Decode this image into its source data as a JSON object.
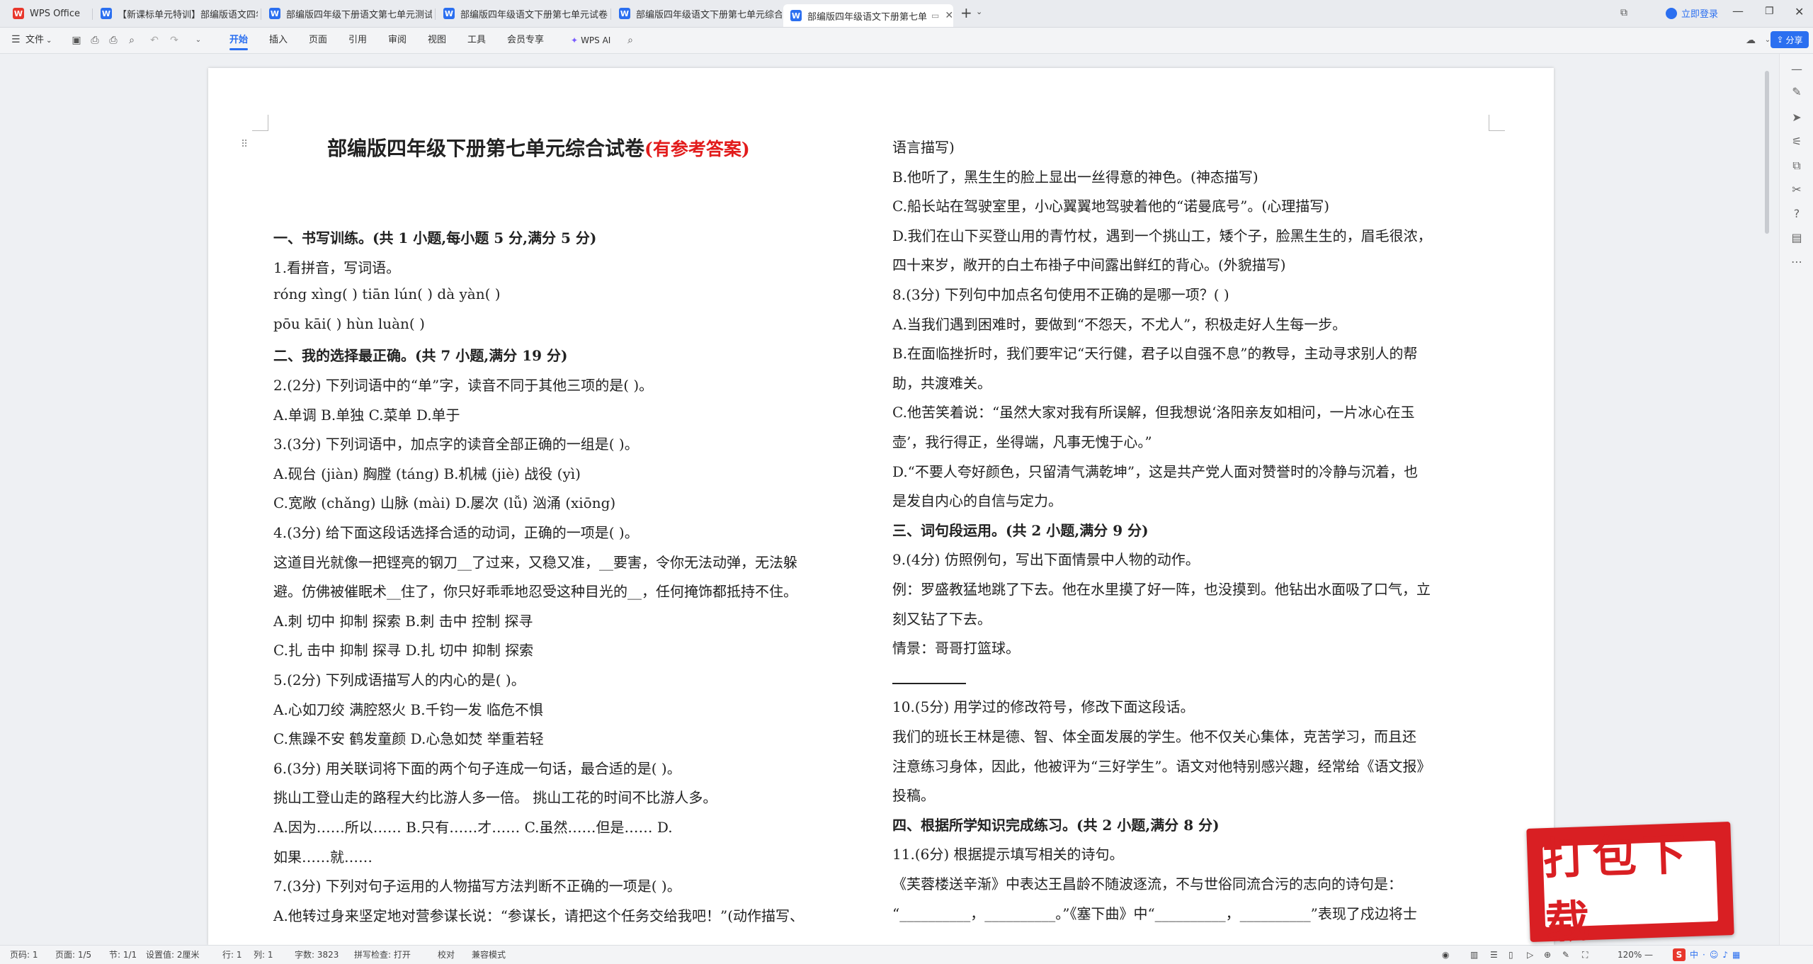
{
  "tabs": [
    {
      "label": "WPS Office",
      "type": "wps"
    },
    {
      "label": "【新课标单元特训】部编版语文四年",
      "type": "doc"
    },
    {
      "label": "部编版四年级下册语文第七单元测试",
      "type": "doc"
    },
    {
      "label": "部编版四年级语文下册第七单元试卷",
      "type": "doc"
    },
    {
      "label": "部编版四年级语文下册第七单元综合",
      "type": "doc"
    },
    {
      "label": "部编版四年级语文下册第七单",
      "type": "doc"
    }
  ],
  "titlebar": {
    "login": "立即登录",
    "new_tab": "+"
  },
  "menubar": {
    "file": "文件",
    "items": [
      "开始",
      "插入",
      "页面",
      "引用",
      "审阅",
      "视图",
      "工具",
      "会员专享"
    ],
    "ai": "WPS AI",
    "share": "分享"
  },
  "doc": {
    "title": "部编版四年级下册第七单元综合试卷",
    "title_red": "(有参考答案)",
    "left": [
      {
        "t": "一、书写训练。(共 1 小题,每小题 5 分,满分 5 分)",
        "bold": true
      },
      {
        "t": "1.看拼音，写词语。"
      },
      {
        "t": "róng xìng( )  tiān lún( ) dà yàn( )"
      },
      {
        "t": " pōu kāi( )  hùn luàn( )"
      },
      {
        "t": "二、我的选择最正确。(共 7 小题,满分 19 分)",
        "bold": true
      },
      {
        "t": "2.(2分) 下列词语中的“单”字，读音不同于其他三项的是(  )。"
      },
      {
        "t": "A.单调                B.单独                C.菜单                D.单于"
      },
      {
        "t": "3.(3分) 下列词语中，加点字的读音全部正确的一组是(  )。"
      },
      {
        "t": "A.砚台 (jiàn)        胸膛 (táng)   B.机械 (jiè)          战役 (yì)"
      },
      {
        "t": "C.宽敞 (chǎng)    山脉 (mài)         D.屡次 (lǚ)         汹涌 (xiōng)"
      },
      {
        "t": "4.(3分) 给下面这段话选择合适的动词，正确的一项是(  )。"
      },
      {
        "t": "  这道目光就像一把铿亮的钢刀__了过来，又稳又准，__要害，令你无法动弹，无法躲"
      },
      {
        "t": "避。仿佛被催眠术__住了，你只好乖乖地忍受这种目光的__，任何掩饰都抵持不住。"
      },
      {
        "t": "A.刺  切中  抑制  探索                   B.刺  击中  控制  探寻"
      },
      {
        "t": "C.扎  击中  抑制  探寻                   D.扎  切中  抑制  探索"
      },
      {
        "t": "5.(2分) 下列成语描写人的内心的是(  )。"
      },
      {
        "t": "A.心如刀绞  满腔怒火                     B.千钧一发  临危不惧"
      },
      {
        "t": "C.焦躁不安  鹤发童颜                     D.心急如焚  举重若轻"
      },
      {
        "t": "6.(3分) 用关联词将下面的两个句子连成一句话，最合适的是(  )。"
      },
      {
        "t": "  挑山工登山走的路程大约比游人多一倍。 挑山工花的时间不比游人多。"
      },
      {
        "t": "A.因为……所以……                         B.只有……才……   C.虽然……但是……   D."
      },
      {
        "t": "如果……就……"
      },
      {
        "t": "7.(3分) 下列对句子运用的人物描写方法判断不正确的一项是(  )。"
      },
      {
        "t": "A.他转过身来坚定地对营参谋长说：“参谋长，请把这个任务交给我吧！”(动作描写、"
      }
    ],
    "right": [
      {
        "t": "语言描写)"
      },
      {
        "t": "B.他听了，黑生生的脸上显出一丝得意的神色。(神态描写)"
      },
      {
        "t": "C.船长站在驾驶室里，小心翼翼地驾驶着他的“诺曼底号”。(心理描写)"
      },
      {
        "t": "D.我们在山下买登山用的青竹杖，遇到一个挑山工，矮个子，脸黑生生的，眉毛很浓，"
      },
      {
        "t": "四十来岁，敞开的白土布褂子中间露出鲜红的背心。(外貌描写)"
      },
      {
        "t": "8.(3分) 下列句中加点名句使用不正确的是哪一项？(  )"
      },
      {
        "t": "A.当我们遇到困难时，要做到“不怨天，不尤人”，积极走好人生每一步。"
      },
      {
        "t": "B.在面临挫折时，我们要牢记“天行健，君子以自强不息”的教导，主动寻求别人的帮"
      },
      {
        "t": "助，共渡难关。"
      },
      {
        "t": "C.他苦笑着说：“虽然大家对我有所误解，但我想说‘洛阳亲友如相问，一片冰心在玉"
      },
      {
        "t": "壶’，我行得正，坐得端，凡事无愧于心。”"
      },
      {
        "t": "D.“不要人夸好颜色，只留清气满乾坤”，这是共产党人面对赞誉时的冷静与沉着，也"
      },
      {
        "t": "是发自内心的自信与定力。"
      },
      {
        "t": "三、词句段运用。(共 2 小题,满分 9 分)",
        "bold": true
      },
      {
        "t": "9.(4分) 仿照例句，写出下面情景中人物的动作。"
      },
      {
        "t": "例：罗盛教猛地跳了下去。他在水里摸了好一阵，也没摸到。他钻出水面吸了口气，立"
      },
      {
        "t": "刻又钻了下去。"
      },
      {
        "t": "情景：哥哥打篮球。"
      },
      {
        "t": ""
      },
      {
        "t": "10.(5分) 用学过的修改符号，修改下面这段话。"
      },
      {
        "t": "  我们的班长王林是德、智、体全面发展的学生。他不仅关心集体，克苦学习，而且还"
      },
      {
        "t": "注意练习身体，因此，他被评为“三好学生”。语文对他特别感兴趣，经常给《语文报》"
      },
      {
        "t": "投稿。"
      },
      {
        "t": "四、根据所学知识完成练习。(共 2 小题,满分 8 分)",
        "bold": true
      },
      {
        "t": "11.(6分) 根据提示填写相关的诗句。"
      },
      {
        "t": "  《芙蓉楼送辛渐》中表达王昌龄不随波逐流，不与世俗同流合污的志向的诗句是："
      },
      {
        "t": "“__________，__________。”《塞下曲》中“__________，__________”表现了戍边将士"
      }
    ]
  },
  "status": {
    "page": "页码: 1",
    "pages": "页面: 1/5",
    "section": "节: 1/1",
    "setting": "设置值: 2厘米",
    "row": "行: 1",
    "col": "列: 1",
    "words": "字数: 3823",
    "spell": "拼写检查: 打开",
    "proof": "校对",
    "compat": "兼容模式",
    "zoom": "120%"
  },
  "download_banner": "打包下载"
}
